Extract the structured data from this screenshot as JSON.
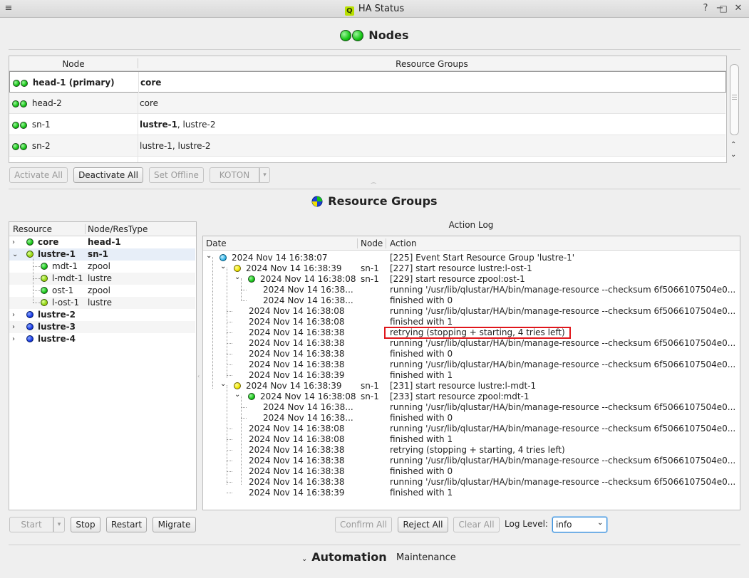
{
  "window": {
    "title": "HA Status",
    "menu_icon": "menu-icon",
    "logo_letter": "Q"
  },
  "nodes_section": {
    "title": "Nodes",
    "columns": [
      "Node",
      "Resource Groups"
    ],
    "rows": [
      {
        "node": "head-1 (primary)",
        "groups_bold": "core",
        "groups_rest": "",
        "bold_node": true
      },
      {
        "node": "head-2",
        "groups_bold": "",
        "groups_rest": "core",
        "bold_node": false
      },
      {
        "node": "sn-1",
        "groups_bold": "lustre-1",
        "groups_rest": ", lustre-2",
        "bold_node": false
      },
      {
        "node": "sn-2",
        "groups_bold": "",
        "groups_rest": "lustre-1, lustre-2",
        "bold_node": false
      }
    ],
    "buttons": {
      "activate_all": "Activate All",
      "deactivate_all": "Deactivate All",
      "set_offline": "Set Offline",
      "koton": "KOTON"
    }
  },
  "rg_section": {
    "title": "Resource Groups",
    "tree_columns": [
      "Resource",
      "Node/ResType"
    ],
    "tree": [
      {
        "name": "core",
        "type": "head-1",
        "bold": true,
        "dot": "g",
        "level": 0,
        "arrow": "›"
      },
      {
        "name": "lustre-1",
        "type": "sn-1",
        "bold": true,
        "dot": "gy",
        "level": 0,
        "arrow": "⌄"
      },
      {
        "name": "mdt-1",
        "type": "zpool",
        "bold": false,
        "dot": "g",
        "level": 1,
        "arrow": ""
      },
      {
        "name": "l-mdt-1",
        "type": "lustre",
        "bold": false,
        "dot": "gy",
        "level": 1,
        "arrow": ""
      },
      {
        "name": "ost-1",
        "type": "zpool",
        "bold": false,
        "dot": "g",
        "level": 1,
        "arrow": ""
      },
      {
        "name": "l-ost-1",
        "type": "lustre",
        "bold": false,
        "dot": "gy",
        "level": 1,
        "arrow": ""
      },
      {
        "name": "lustre-2",
        "type": "",
        "bold": true,
        "dot": "b",
        "level": 0,
        "arrow": "›"
      },
      {
        "name": "lustre-3",
        "type": "",
        "bold": true,
        "dot": "b",
        "level": 0,
        "arrow": "›"
      },
      {
        "name": "lustre-4",
        "type": "",
        "bold": true,
        "dot": "b",
        "level": 0,
        "arrow": "›"
      }
    ],
    "tree_buttons": {
      "start": "Start",
      "stop": "Stop",
      "restart": "Restart",
      "migrate": "Migrate"
    },
    "action_log": {
      "title": "Action Log",
      "columns": [
        "Date",
        "Node",
        "Action"
      ],
      "rows": [
        {
          "date": "2024 Nov 14 16:38:07",
          "node": "",
          "action": "[225] Event Start Resource Group 'lustre-1'",
          "dot": "c",
          "indent": 0,
          "arrow": "⌄"
        },
        {
          "date": "2024 Nov 14 16:38:39",
          "node": "sn-1",
          "action": "[227] start resource lustre:l-ost-1",
          "dot": "y",
          "indent": 1,
          "arrow": "⌄"
        },
        {
          "date": "2024 Nov 14 16:38:08",
          "node": "sn-1",
          "action": "[229] start resource zpool:ost-1",
          "dot": "g",
          "indent": 2,
          "arrow": "⌄"
        },
        {
          "date": "2024 Nov 14 16:38...",
          "node": "",
          "action": "running '/usr/lib/qlustar/HA/bin/manage-resource --checksum 6f5066107504e0...",
          "dot": "",
          "indent": 3,
          "arrow": ""
        },
        {
          "date": "2024 Nov 14 16:38...",
          "node": "",
          "action": "finished with 0",
          "dot": "",
          "indent": 3,
          "arrow": ""
        },
        {
          "date": "2024 Nov 14 16:38:08",
          "node": "",
          "action": "running '/usr/lib/qlustar/HA/bin/manage-resource --checksum 6f5066107504e0...",
          "dot": "",
          "indent": 2,
          "arrow": ""
        },
        {
          "date": "2024 Nov 14 16:38:08",
          "node": "",
          "action": "finished with 1",
          "dot": "",
          "indent": 2,
          "arrow": ""
        },
        {
          "date": "2024 Nov 14 16:38:38",
          "node": "",
          "action": "retrying (stopping + starting, 4 tries left)",
          "dot": "",
          "indent": 2,
          "arrow": "",
          "highlight": true
        },
        {
          "date": "2024 Nov 14 16:38:38",
          "node": "",
          "action": "running '/usr/lib/qlustar/HA/bin/manage-resource --checksum 6f5066107504e0...",
          "dot": "",
          "indent": 2,
          "arrow": ""
        },
        {
          "date": "2024 Nov 14 16:38:38",
          "node": "",
          "action": "finished with 0",
          "dot": "",
          "indent": 2,
          "arrow": ""
        },
        {
          "date": "2024 Nov 14 16:38:38",
          "node": "",
          "action": "running '/usr/lib/qlustar/HA/bin/manage-resource --checksum 6f5066107504e0...",
          "dot": "",
          "indent": 2,
          "arrow": ""
        },
        {
          "date": "2024 Nov 14 16:38:39",
          "node": "",
          "action": "finished with 1",
          "dot": "",
          "indent": 2,
          "arrow": ""
        },
        {
          "date": "2024 Nov 14 16:38:39",
          "node": "sn-1",
          "action": "[231] start resource lustre:l-mdt-1",
          "dot": "y",
          "indent": 1,
          "arrow": "⌄"
        },
        {
          "date": "2024 Nov 14 16:38:08",
          "node": "sn-1",
          "action": "[233] start resource zpool:mdt-1",
          "dot": "g",
          "indent": 2,
          "arrow": "⌄"
        },
        {
          "date": "2024 Nov 14 16:38...",
          "node": "",
          "action": "running '/usr/lib/qlustar/HA/bin/manage-resource --checksum 6f5066107504e0...",
          "dot": "",
          "indent": 3,
          "arrow": ""
        },
        {
          "date": "2024 Nov 14 16:38...",
          "node": "",
          "action": "finished with 0",
          "dot": "",
          "indent": 3,
          "arrow": ""
        },
        {
          "date": "2024 Nov 14 16:38:08",
          "node": "",
          "action": "running '/usr/lib/qlustar/HA/bin/manage-resource --checksum 6f5066107504e0...",
          "dot": "",
          "indent": 2,
          "arrow": ""
        },
        {
          "date": "2024 Nov 14 16:38:08",
          "node": "",
          "action": "finished with 1",
          "dot": "",
          "indent": 2,
          "arrow": ""
        },
        {
          "date": "2024 Nov 14 16:38:38",
          "node": "",
          "action": "retrying (stopping + starting, 4 tries left)",
          "dot": "",
          "indent": 2,
          "arrow": ""
        },
        {
          "date": "2024 Nov 14 16:38:38",
          "node": "",
          "action": "running '/usr/lib/qlustar/HA/bin/manage-resource --checksum 6f5066107504e0...",
          "dot": "",
          "indent": 2,
          "arrow": ""
        },
        {
          "date": "2024 Nov 14 16:38:38",
          "node": "",
          "action": "finished with 0",
          "dot": "",
          "indent": 2,
          "arrow": ""
        },
        {
          "date": "2024 Nov 14 16:38:38",
          "node": "",
          "action": "running '/usr/lib/qlustar/HA/bin/manage-resource --checksum 6f5066107504e0...",
          "dot": "",
          "indent": 2,
          "arrow": ""
        },
        {
          "date": "2024 Nov 14 16:38:39",
          "node": "",
          "action": "finished with 1",
          "dot": "",
          "indent": 2,
          "arrow": ""
        }
      ],
      "buttons": {
        "confirm_all": "Confirm All",
        "reject_all": "Reject All",
        "clear_all": "Clear All"
      },
      "log_level_label": "Log Level:",
      "log_level_value": "info"
    }
  },
  "footer": {
    "automation": "Automation",
    "maintenance": "Maintenance"
  },
  "colors": {
    "highlight_border": "#e0161b"
  }
}
